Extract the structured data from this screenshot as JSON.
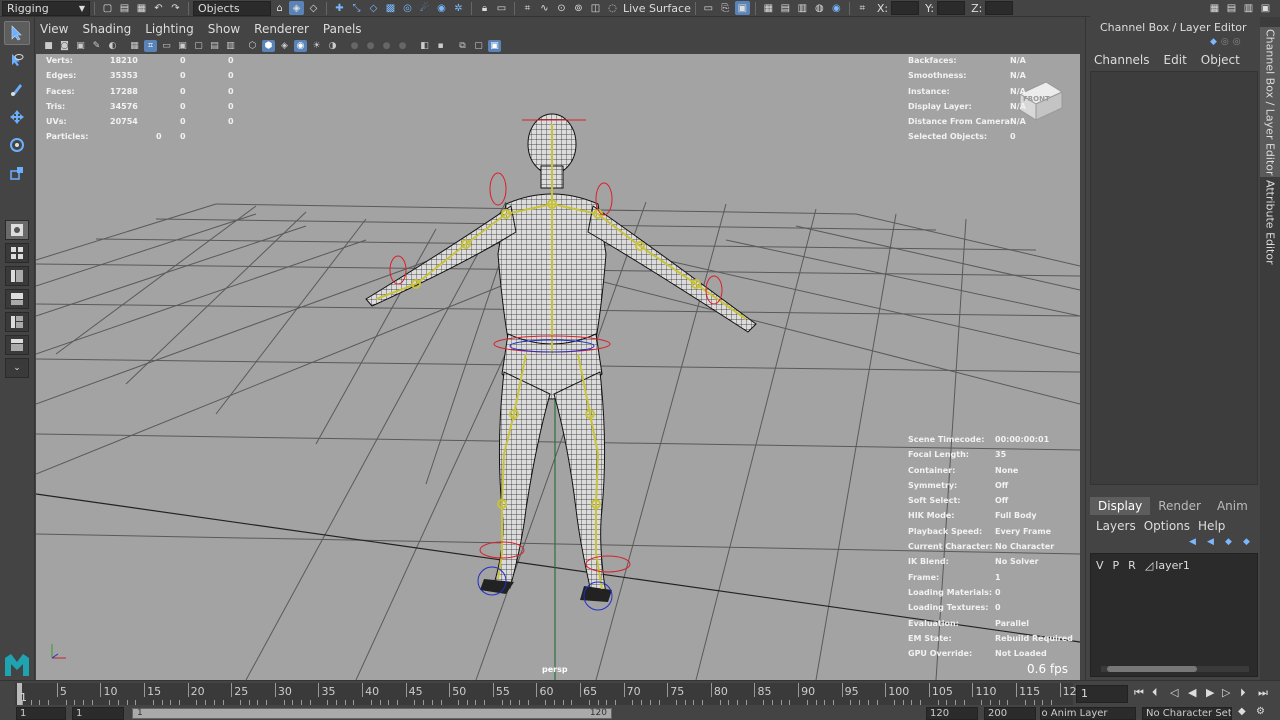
{
  "statusline": {
    "menuset": "Rigging",
    "selection_mode": "Objects",
    "live_surface": "Live Surface",
    "x_label": "X:",
    "y_label": "Y:",
    "z_label": "Z:"
  },
  "viewport_menu": [
    "View",
    "Shading",
    "Lighting",
    "Show",
    "Renderer",
    "Panels"
  ],
  "poly_count": {
    "rows": [
      {
        "label": "Verts:",
        "v1": "18210",
        "v2": "0",
        "v3": "0"
      },
      {
        "label": "Edges:",
        "v1": "35353",
        "v2": "0",
        "v3": "0"
      },
      {
        "label": "Faces:",
        "v1": "17288",
        "v2": "0",
        "v3": "0"
      },
      {
        "label": "Tris:",
        "v1": "34576",
        "v2": "0",
        "v3": "0"
      },
      {
        "label": "UVs:",
        "v1": "20754",
        "v2": "0",
        "v3": "0"
      }
    ],
    "particles": {
      "label": "Particles:",
      "v1": "0",
      "v2": "0"
    }
  },
  "hud_top_right": [
    {
      "label": "Backfaces:",
      "value": "N/A"
    },
    {
      "label": "Smoothness:",
      "value": "N/A"
    },
    {
      "label": "Instance:",
      "value": "N/A"
    },
    {
      "label": "Display Layer:",
      "value": "N/A"
    },
    {
      "label": "Distance From Camera:",
      "value": "N/A"
    },
    {
      "label": "Selected Objects:",
      "value": "0"
    }
  ],
  "hud_bottom_right": [
    {
      "label": "Scene Timecode:",
      "value": "00:00:00:01"
    },
    {
      "label": "Focal Length:",
      "value": "35"
    },
    {
      "label": "Container:",
      "value": "None"
    },
    {
      "label": "Symmetry:",
      "value": "Off"
    },
    {
      "label": "Soft Select:",
      "value": "Off"
    },
    {
      "label": "HIK Mode:",
      "value": "Full Body"
    },
    {
      "label": "Playback Speed:",
      "value": "Every Frame"
    },
    {
      "label": "Current Character:",
      "value": "No Character"
    },
    {
      "label": "IK Blend:",
      "value": "No Solver"
    },
    {
      "label": "Frame:",
      "value": "1"
    },
    {
      "label": "Loading Materials:",
      "value": "0"
    },
    {
      "label": "Loading Textures:",
      "value": "0"
    },
    {
      "label": "Evaluation:",
      "value": "Parallel"
    },
    {
      "label": "EM State:",
      "value": "Rebuild Required"
    },
    {
      "label": "GPU Override:",
      "value": "Not Loaded"
    }
  ],
  "viewport": {
    "camera": "persp",
    "fps": "0.6 fps",
    "view_cube": "FRONT",
    "grid_color": "#2f2f2f",
    "background": "#a3a3a3",
    "joint_color": "#c8c23a",
    "control_color": "#d8202a"
  },
  "channel_box": {
    "title": "Channel Box / Layer Editor",
    "menu": [
      "Channels",
      "Edit",
      "Object"
    ]
  },
  "layer_editor": {
    "tabs": [
      "Display",
      "Render",
      "Anim"
    ],
    "menu": [
      "Layers",
      "Options",
      "Help"
    ],
    "layers": [
      {
        "v": "V",
        "p": "P",
        "r": "R",
        "name": "layer1"
      }
    ]
  },
  "side_tabs": [
    "Channel Box / Layer Editor",
    "Attribute Editor"
  ],
  "timeslider": {
    "labels": [
      "5",
      "10",
      "15",
      "20",
      "25",
      "30",
      "35",
      "40",
      "45",
      "50",
      "55",
      "60",
      "65",
      "70",
      "75",
      "80",
      "85",
      "90",
      "95",
      "100",
      "105",
      "110",
      "115",
      "120"
    ],
    "current_frame": "1",
    "current_frame_field": "1"
  },
  "rangeslider": {
    "start": "1",
    "playback_start": "1",
    "range_start": "1",
    "range_end": "120",
    "end": "120",
    "playback_end": "200",
    "anim_layer": "No Anim Layer",
    "character_set": "No Character Set"
  }
}
